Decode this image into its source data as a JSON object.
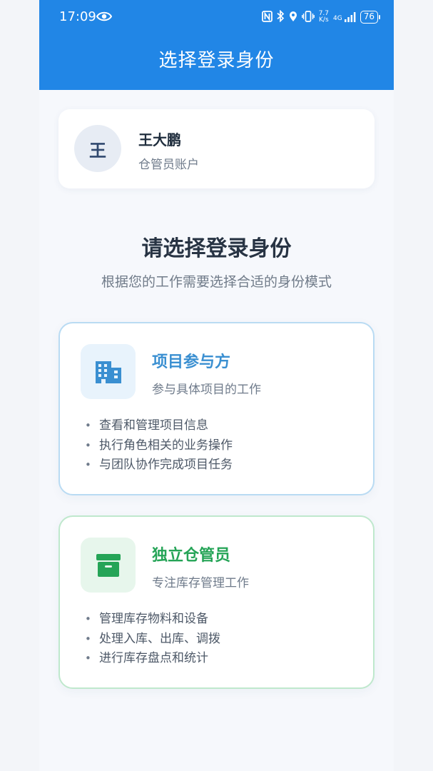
{
  "status_bar": {
    "time": "17:09",
    "icons": [
      "eye-icon",
      "nfc-icon",
      "bluetooth-icon",
      "location-icon",
      "vibrate-icon",
      "network-speed-icon",
      "signal-4g-icon",
      "battery-icon"
    ],
    "network_speed": "7.7\nK/s",
    "network_type": "4G",
    "battery": "76"
  },
  "header": {
    "title": "选择登录身份"
  },
  "user": {
    "avatar_initial": "王",
    "name": "王大鹏",
    "role": "仓管员账户"
  },
  "main": {
    "heading": "请选择登录身份",
    "subheading": "根据您的工作需要选择合适的身份模式"
  },
  "roles": [
    {
      "title": "项目参与方",
      "description": "参与具体项目的工作",
      "icon": "building-icon",
      "accent": "#3a8fd1",
      "features": [
        "查看和管理项目信息",
        "执行角色相关的业务操作",
        "与团队协作完成项目任务"
      ]
    },
    {
      "title": "独立仓管员",
      "description": "专注库存管理工作",
      "icon": "archive-box-icon",
      "accent": "#25a457",
      "features": [
        "管理库存物料和设备",
        "处理入库、出库、调拨",
        "进行库存盘点和统计"
      ]
    }
  ],
  "colors": {
    "header": "#2186e6",
    "background": "#f6f8fc"
  }
}
